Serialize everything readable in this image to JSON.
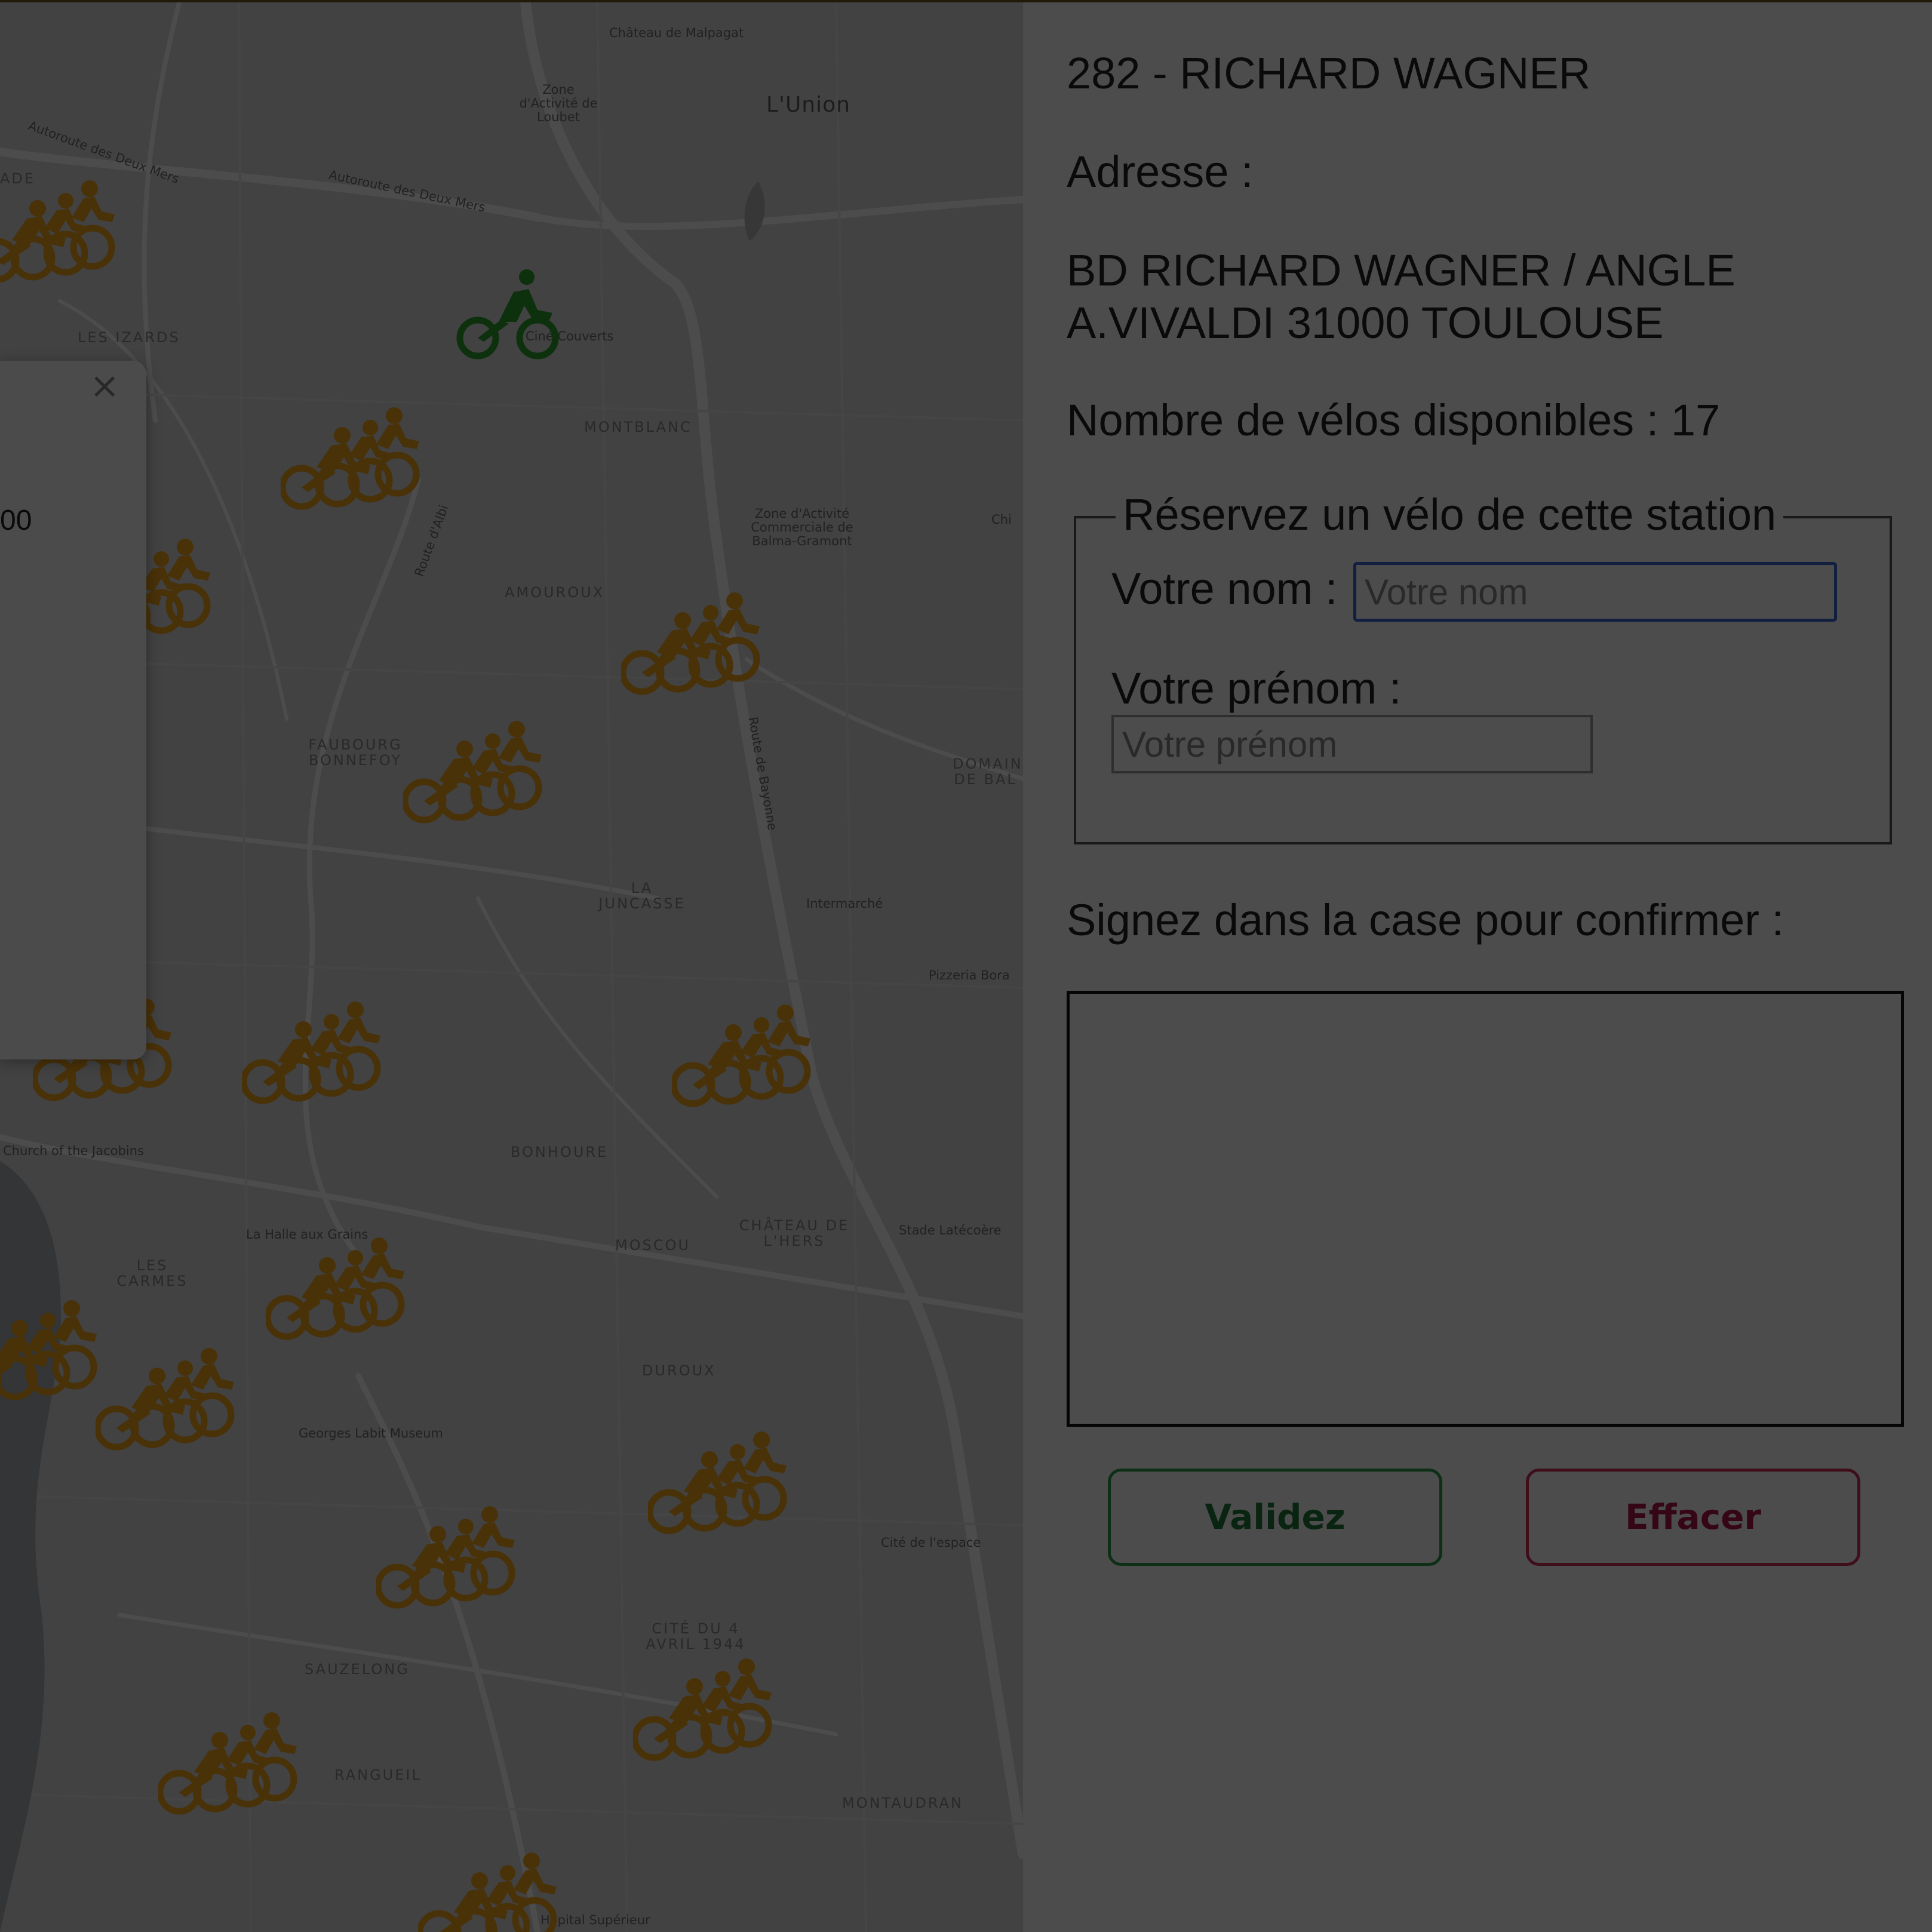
{
  "map": {
    "place_labels": {
      "l01": "Château de Malpagat",
      "l02": "Zone d'Activité de Loubet",
      "l03": "L'Union",
      "l04": "Autoroute des Deux Mers",
      "l05": "Autoroute des Deux Mers",
      "l06": "LES IZARDS",
      "l07": "Ciné Couverts",
      "l08": "MONTBLANC",
      "l09": "Zone d'Activité Commerciale de Balma-Gramont",
      "l10": "AMOUROUX",
      "l11": "FAUBOURG BONNEFOY",
      "l12": "LA JUNCASSE",
      "l13": "Intermarché",
      "l14": "Pizzeria Bora",
      "l15": "DOMAINE DE BAL",
      "l16": "Church of the Jacobins",
      "l17": "BONHOURE",
      "l18": "CHÂTEAU DE L'HERS",
      "l19": "MOSCOU",
      "l20": "Stade Latécoère",
      "l21": "La Halle aux Grains",
      "l22": "LES CARMES",
      "l23": "DUROUX",
      "l24": "Georges Labit Museum",
      "l25": "Cité de l'espace",
      "l26": "CITÉ DU 4 AVRIL 1944",
      "l27": "SAUZELONG",
      "l28": "MONTAUDRAN",
      "l29": "RANGUEIL",
      "l30": "Route d'Albi",
      "l31": "Chi",
      "l32": "Route de Bayonne",
      "l33": "Hôpital Supérieur",
      "l34": "ADE"
    },
    "popup": {
      "close": "×",
      "text": "00"
    }
  },
  "station": {
    "title": "282 - RICHARD WAGNER",
    "address_label": "Adresse :",
    "address_line1": "BD RICHARD WAGNER / ANGLE",
    "address_line2": "A.VIVALDI 31000 TOULOUSE",
    "bikes_available": "Nombre de vélos disponibles : 17"
  },
  "form": {
    "legend": "Réservez un vélo de cette station",
    "nom_label": "Votre nom :",
    "nom_placeholder": "Votre nom",
    "prenom_label": "Votre prénom :",
    "prenom_placeholder": "Votre prénom",
    "signature_label": "Signez dans la case pour confirmer :",
    "validate_label": "Validez",
    "clear_label": "Effacer"
  },
  "colors": {
    "cluster_marker": "#f3a51c",
    "single_marker": "#2ea02e",
    "validate_border": "#2e9e4a",
    "clear_border": "#d32f5a",
    "input_focus_border": "#3b6bd9"
  },
  "icons": {
    "cluster_marker": "bike-cluster-icon",
    "single_marker": "bike-icon",
    "close": "close-icon"
  }
}
